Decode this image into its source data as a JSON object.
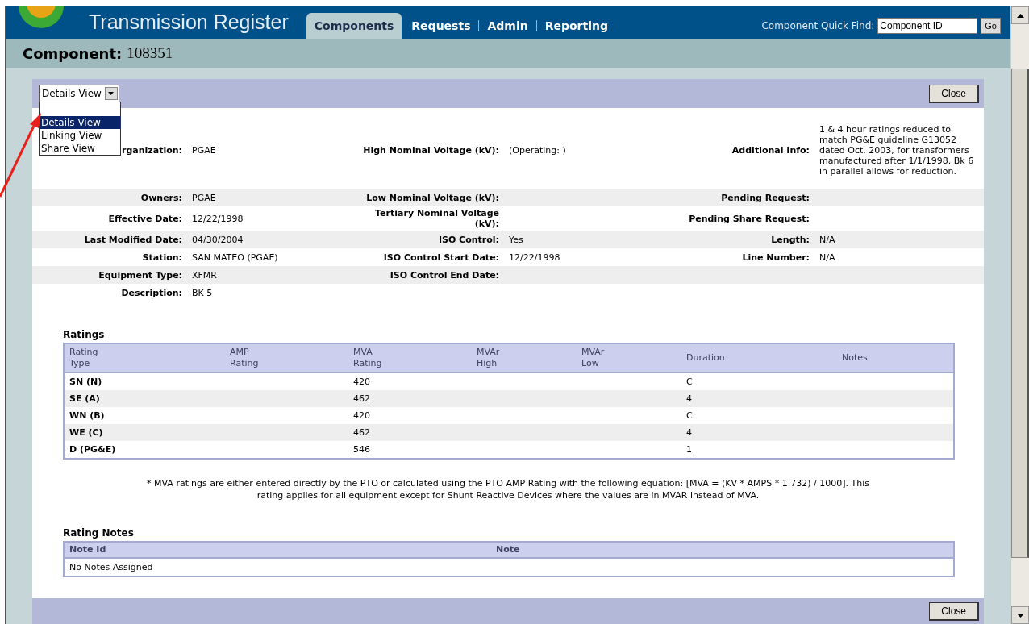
{
  "header": {
    "title": "Transmission Register",
    "tabs": [
      {
        "label": "Components",
        "selected": true
      },
      {
        "label": "Requests",
        "selected": false
      },
      {
        "label": "Admin",
        "selected": false
      },
      {
        "label": "Reporting",
        "selected": false
      }
    ],
    "quick_find": {
      "label": "Component Quick Find:",
      "value": "Component ID",
      "button": "Go"
    }
  },
  "page_title": {
    "label": "Component:",
    "value": "108351"
  },
  "view_select": {
    "value": "Details View",
    "options": [
      {
        "label": "Details View",
        "selected": true
      },
      {
        "label": "Linking View",
        "selected": false
      },
      {
        "label": "Share View",
        "selected": false
      }
    ]
  },
  "close_buttons": [
    "Close",
    "Close"
  ],
  "details": [
    {
      "left": {
        "label": "rganization:",
        "value": "PGAE"
      },
      "middle": {
        "label": "High Nominal Voltage (kV):",
        "value": "(Operating: )"
      },
      "right": {
        "label": "Additional Info:",
        "value": "1 & 4 hour ratings reduced to match PG&E guideline G13052 dated Oct. 2003, for transformers manufactured after 1/1/1998. Bk 6 in parallel allows for reduction."
      }
    },
    {
      "left": {
        "label": "Owners:",
        "value": "PGAE"
      },
      "middle": {
        "label": "Low Nominal Voltage (kV):"
      },
      "right": {
        "label": "Pending Request:"
      }
    },
    {
      "left": {
        "label": "Effective Date:",
        "value": "12/22/1998"
      },
      "middle": {
        "label": "Tertiary Nominal Voltage (kV):"
      },
      "right": {
        "label": "Pending Share Request:"
      }
    },
    {
      "left": {
        "label": "Last Modified Date:",
        "value": "04/30/2004"
      },
      "middle": {
        "label": "ISO Control:",
        "value": "Yes"
      },
      "right": {
        "label": "Length:",
        "value": "N/A"
      }
    },
    {
      "left": {
        "label": "Station:",
        "value": "SAN MATEO (PGAE)"
      },
      "middle": {
        "label": "ISO Control Start Date:",
        "value": "12/22/1998"
      },
      "right": {
        "label": "Line Number:",
        "value": "N/A"
      }
    },
    {
      "left": {
        "label": "Equipment Type:",
        "value": "XFMR"
      },
      "middle": {
        "label": "ISO Control End Date:"
      }
    },
    {
      "left": {
        "label": "Description:",
        "value": "BK 5"
      }
    }
  ],
  "ratings": {
    "title": "Ratings",
    "columns": [
      "Rating\nType",
      "AMP\nRating",
      "MVA\nRating",
      "MVAr\nHigh",
      "MVAr\nLow",
      "Duration",
      "Notes"
    ],
    "rows": [
      {
        "type": "SN (N)",
        "mva": "420",
        "duration": "C"
      },
      {
        "type": "SE (A)",
        "mva": "462",
        "duration": "4"
      },
      {
        "type": "WN (B)",
        "mva": "420",
        "duration": "C"
      },
      {
        "type": "WE (C)",
        "mva": "462",
        "duration": "4"
      },
      {
        "type": "D (PG&E)",
        "mva": "546",
        "duration": "1"
      }
    ]
  },
  "footnote": "* MVA ratings are either entered directly by the PTO or calculated using the PTO AMP Rating with the following equation: [MVA = (KV * AMPS * 1.732) / 1000]. This rating applies for all equipment except for Shunt Reactive Devices where the values are in MVAR instead of MVA.",
  "rating_notes": {
    "title": "Rating Notes",
    "columns": [
      "Note Id",
      "Note"
    ],
    "empty_text": "No Notes Assigned"
  }
}
